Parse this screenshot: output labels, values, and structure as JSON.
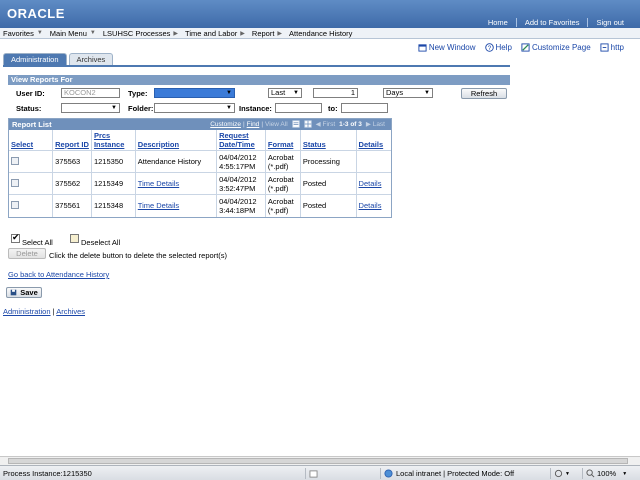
{
  "header": {
    "logo": "ORACLE",
    "links": [
      "Home",
      "Add to Favorites",
      "Sign out"
    ]
  },
  "menubar": {
    "items": [
      "Favorites",
      "Main Menu",
      "LSUHSC Processes",
      "Time and Labor",
      "Report",
      "Attendance History"
    ]
  },
  "util": {
    "new_window": "New Window",
    "help": "Help",
    "customize_page": "Customize Page",
    "http": "http"
  },
  "tabs": [
    "Administration",
    "Archives"
  ],
  "view_reports": {
    "title": "View Reports For",
    "user_id_label": "User ID:",
    "user_id_value": "KOCON2",
    "type_label": "Type:",
    "type_value": "",
    "last_value": "Last",
    "count_value": "1",
    "period_value": "Days",
    "refresh_label": "Refresh",
    "status_label": "Status:",
    "folder_label": "Folder:",
    "instance_label": "Instance:",
    "to_label": "to:"
  },
  "report_list": {
    "title": "Report List",
    "nav": {
      "customize": "Customize",
      "find": "Find",
      "view_all": "View All",
      "first": "First",
      "count": "1-3 of 3",
      "last": "Last"
    },
    "columns": [
      "Select",
      "Report ID",
      "Prcs Instance",
      "Description",
      "Request Date/Time",
      "Format",
      "Status",
      "Details"
    ],
    "rows": [
      {
        "report_id": "375563",
        "prcs_instance": "1215350",
        "description": "Attendance History",
        "request_date": "04/04/2012",
        "request_time": "4:55:17PM",
        "format_a": "Acrobat",
        "format_b": "(*.pdf)",
        "status": "Processing",
        "details": ""
      },
      {
        "report_id": "375562",
        "prcs_instance": "1215349",
        "description": "Time Details",
        "request_date": "04/04/2012",
        "request_time": "3:52:47PM",
        "format_a": "Acrobat",
        "format_b": "(*.pdf)",
        "status": "Posted",
        "details": "Details"
      },
      {
        "report_id": "375561",
        "prcs_instance": "1215348",
        "description": "Time Details",
        "request_date": "04/04/2012",
        "request_time": "3:44:18PM",
        "format_a": "Acrobat",
        "format_b": "(*.pdf)",
        "status": "Posted",
        "details": "Details"
      }
    ]
  },
  "actions": {
    "select_all": "Select All",
    "deselect_all": "Deselect All",
    "delete_label": "Delete",
    "delete_hint": "Click the delete button to delete the selected report(s)",
    "go_back": "Go back to Attendance History",
    "save_label": "Save",
    "footer_admin": "Administration",
    "footer_sep": "|",
    "footer_archives": "Archives"
  },
  "statusbar": {
    "process": "Process Instance:1215350",
    "zone": "Local intranet | Protected Mode: Off",
    "zoom": "100%"
  },
  "colors": {
    "header": "#4e79b1",
    "link": "#1b47a8",
    "section": "#7d9cc3"
  }
}
